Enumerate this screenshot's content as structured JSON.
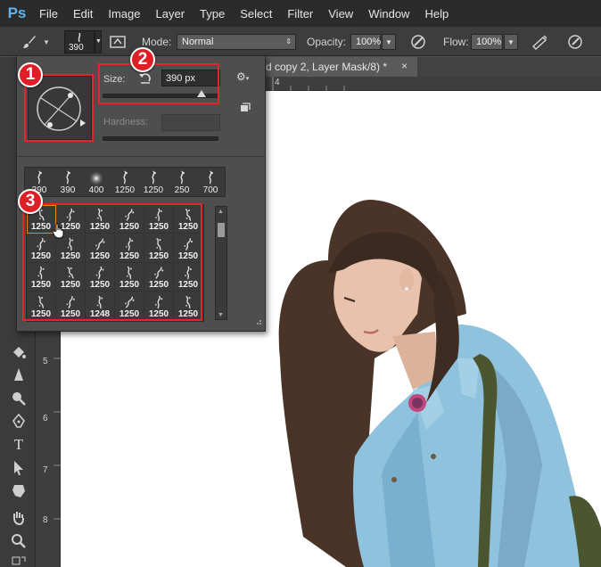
{
  "app": {
    "logo": "Ps"
  },
  "menu": [
    "File",
    "Edit",
    "Image",
    "Layer",
    "Type",
    "Select",
    "Filter",
    "View",
    "Window",
    "Help"
  ],
  "options_bar": {
    "brush_size": "390",
    "mode_label": "Mode:",
    "mode_value": "Normal",
    "opacity_label": "Opacity:",
    "opacity_value": "100%",
    "flow_label": "Flow:",
    "flow_value": "100%"
  },
  "document_tab": {
    "title": "d copy 2, Layer Mask/8) *",
    "close": "×"
  },
  "ruler": {
    "h_mark": "4",
    "v_marks": [
      "5",
      "6",
      "7",
      "8"
    ]
  },
  "brush_picker": {
    "size_label": "Size:",
    "size_value": "390 px",
    "hardness_label": "Hardness:",
    "recent_tips": [
      "390",
      "390",
      "400",
      "1250",
      "1250",
      "250",
      "700"
    ],
    "grid_values": [
      "1250",
      "1250",
      "1250",
      "1250",
      "1250",
      "1250",
      "1250",
      "1250",
      "1250",
      "1250",
      "1250",
      "1250",
      "1250",
      "1250",
      "1250",
      "1250",
      "1250",
      "1250",
      "1250",
      "1250",
      "1248",
      "1250",
      "1250",
      "1250"
    ]
  },
  "annotations": {
    "badge1": "1",
    "badge2": "2",
    "badge3": "3"
  },
  "colors": {
    "annotation_red": "#e5252a",
    "accent_blue": "#5fb4ee",
    "selection_orange": "#e08a20"
  }
}
